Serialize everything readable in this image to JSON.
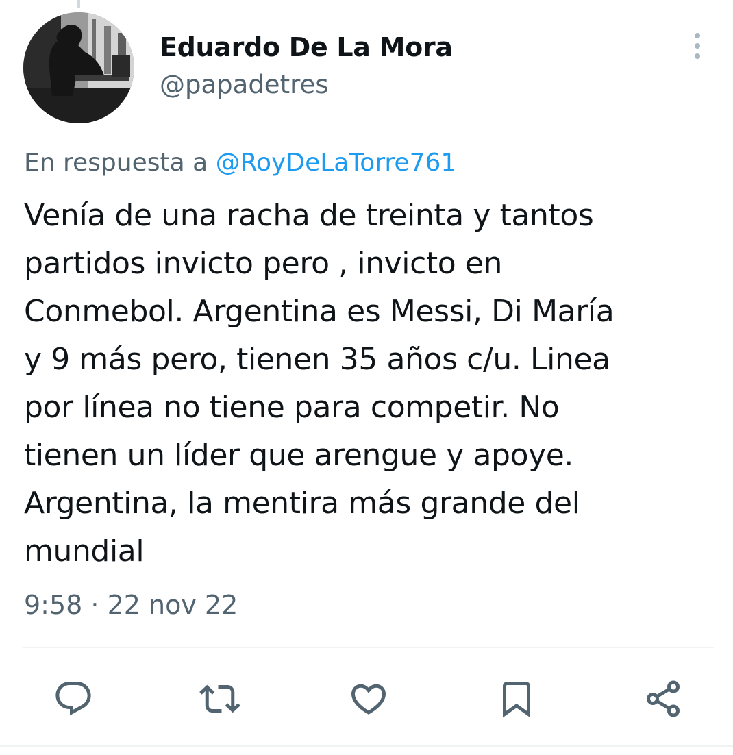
{
  "author": {
    "display_name": "Eduardo De La Mora",
    "handle": "@papadetres"
  },
  "reply": {
    "prefix": "En respuesta a",
    "target": "@RoyDeLaTorre761"
  },
  "tweet": {
    "lines": [
      "Venía de una racha de treinta y tantos",
      "partidos invicto pero , invicto en",
      "Conmebol. Argentina es Messi, Di María",
      "y 9 más pero, tienen 35 años c/u. Linea",
      "por línea no tiene para competir. No",
      "tienen un líder que arengue y apoye.",
      "Argentina, la mentira más grande del",
      "mundial"
    ],
    "timestamp": "9:58 · 22 nov 22"
  },
  "actions": {
    "icons": [
      "reply-icon",
      "retweet-icon",
      "like-icon",
      "bookmark-icon",
      "share-icon"
    ]
  },
  "colors": {
    "text": "#0f1419",
    "secondary": "#536471",
    "link": "#1d9bf0",
    "divider": "#eff3f4"
  }
}
